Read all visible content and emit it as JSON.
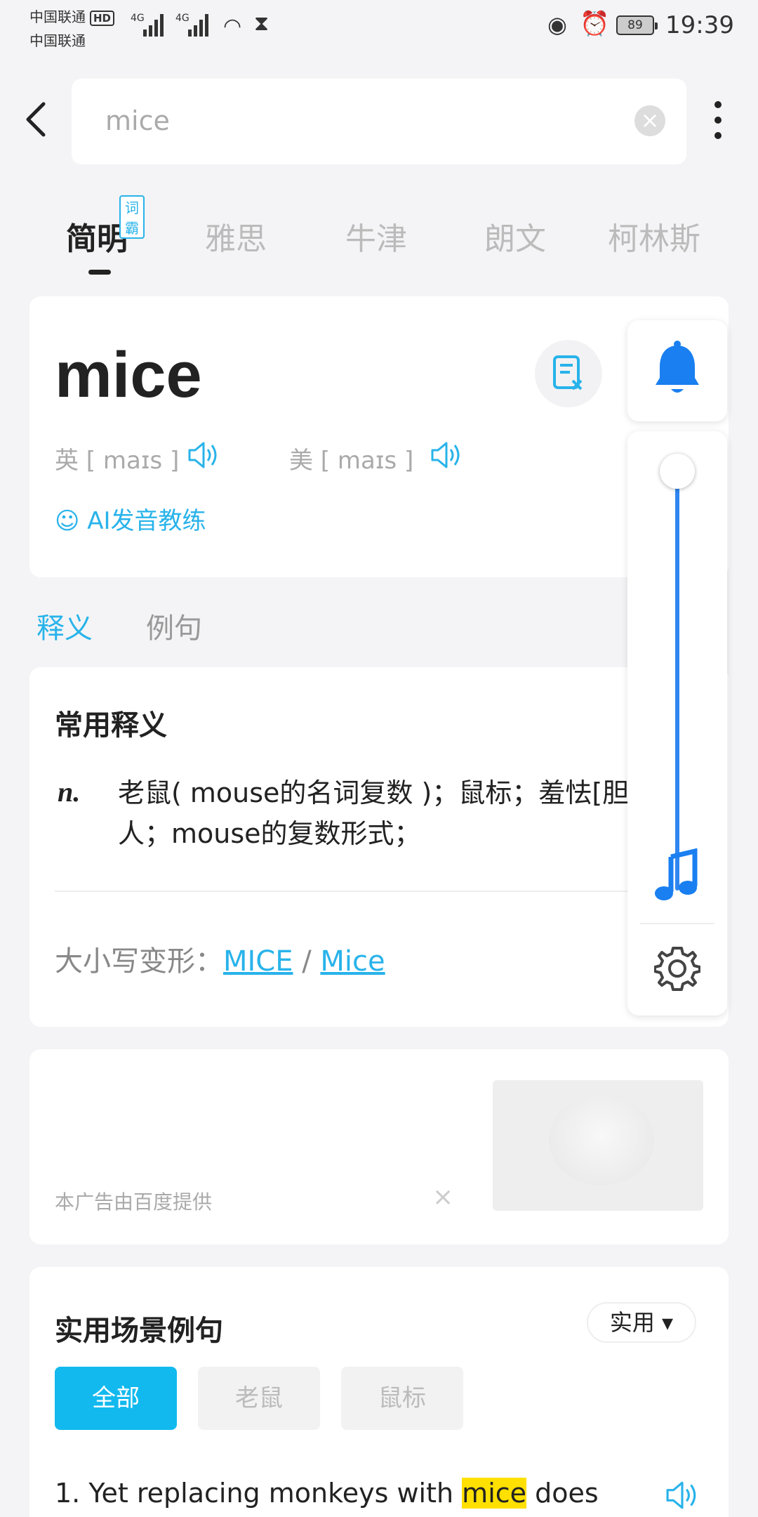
{
  "status": {
    "carrier1": "中国联通",
    "carrier2": "中国联通",
    "hd": "HD",
    "net1": "4G",
    "net2": "4G",
    "battery": "89",
    "time": "19:39"
  },
  "search": {
    "value": "mice"
  },
  "dict_tabs": [
    {
      "label": "简明",
      "badge": "词霸"
    },
    {
      "label": "雅思"
    },
    {
      "label": "牛津"
    },
    {
      "label": "朗文"
    },
    {
      "label": "柯林斯"
    }
  ],
  "word": {
    "headword": "mice",
    "uk_label": "英 [ maɪs ]",
    "us_label": "美 [  maɪs ]",
    "ai_coach": "AI发音教练"
  },
  "section_tabs": [
    "释义",
    "例句"
  ],
  "definition": {
    "title": "常用释义",
    "pos": "n.",
    "text": "老鼠( mouse的名词复数 )；鼠标；羞怯[胆小]的人；mouse的复数形式；",
    "variants_label": "大小写变形：",
    "variant1": "MICE",
    "separator": " / ",
    "variant2": "Mice"
  },
  "ad": {
    "label": "本广告由百度提供",
    "close": "×"
  },
  "examples": {
    "title": "实用场景例句",
    "filter": "实用 ▾",
    "chips": [
      "全部",
      "老鼠",
      "鼠标"
    ],
    "sentence_before": "1. Yet replacing monkeys with ",
    "sentence_highlight": "mice",
    "sentence_after": " does"
  },
  "colors": {
    "accent": "#28b3ea",
    "slider": "#2f86f0",
    "highlight": "#ffe000"
  },
  "icons": [
    "back-arrow-icon",
    "clear-icon",
    "more-icon",
    "wordbook-icon",
    "speaker-icon",
    "ai-coach-icon",
    "bell-icon",
    "music-note-icon",
    "gear-icon"
  ]
}
